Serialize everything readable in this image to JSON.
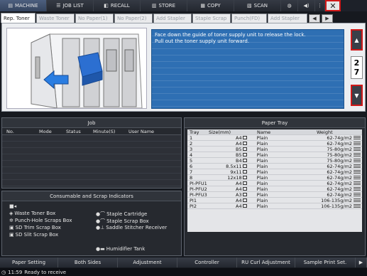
{
  "topbar": {
    "tabs": [
      {
        "label": "MACHINE",
        "icon": "machine-icon"
      },
      {
        "label": "JOB LIST",
        "icon": "list-icon"
      },
      {
        "label": "RECALL",
        "icon": "recall-icon"
      },
      {
        "label": "STORE",
        "icon": "store-icon"
      },
      {
        "label": "COPY",
        "icon": "copy-icon"
      },
      {
        "label": "SCAN",
        "icon": "scan-icon"
      }
    ],
    "close_label": "✕"
  },
  "tabs": [
    "Rep. Toner",
    "Waste Toner",
    "No Paper(1)",
    "No Paper(2)",
    "Add Stapler",
    "Staple Scrap",
    "Punch(FD)",
    "Add Stapler"
  ],
  "guidance": {
    "line1": "Face down the guide of toner supply unit to release the lock.",
    "line2": "Pull out the toner supply unit forward.",
    "page_current": "2",
    "page_total": "7"
  },
  "job": {
    "title": "Job",
    "columns": [
      "No.",
      "Mode",
      "Status",
      "Minute(S)",
      "User Name"
    ]
  },
  "paper_tray": {
    "title": "Paper Tray",
    "columns": [
      "Tray",
      "Size(mm)",
      "Name",
      "Weight"
    ],
    "rows": [
      {
        "tray": "1",
        "size": "A4",
        "name": "Plain",
        "weight": "62-74g/m2"
      },
      {
        "tray": "2",
        "size": "A4",
        "name": "Plain",
        "weight": "62-74g/m2"
      },
      {
        "tray": "3",
        "size": "B5",
        "name": "Plain",
        "weight": "75-80g/m2"
      },
      {
        "tray": "4",
        "size": "B5",
        "name": "Plain",
        "weight": "75-80g/m2"
      },
      {
        "tray": "5",
        "size": "B4",
        "name": "Plain",
        "weight": "75-80g/m2"
      },
      {
        "tray": "6",
        "size": "8.5x11",
        "name": "Plain",
        "weight": "62-74g/m2"
      },
      {
        "tray": "7",
        "size": "9x11",
        "name": "Plain",
        "weight": "62-74g/m2"
      },
      {
        "tray": "8",
        "size": "12x18",
        "name": "Plain",
        "weight": "62-74g/m2"
      },
      {
        "tray": "PI-PFU1",
        "size": "A4",
        "name": "Plain",
        "weight": "62-74g/m2"
      },
      {
        "tray": "PI-PFU2",
        "size": "A4",
        "name": "Plain",
        "weight": "62-74g/m2"
      },
      {
        "tray": "PI-PFU3",
        "size": "A3",
        "name": "Plain",
        "weight": "62-74g/m2"
      },
      {
        "tray": "PI1",
        "size": "A4",
        "name": "Plain",
        "weight": "106-135g/m2"
      },
      {
        "tray": "PI2",
        "size": "A4",
        "name": "Plain",
        "weight": "106-135g/m2"
      }
    ]
  },
  "consumables": {
    "title": "Consumable and Scrap Indicators",
    "items": [
      "Waste Toner Box",
      "Punch-Hole Scraps Box",
      "SD Trim Scrap Box",
      "SD Slit Scrap Box",
      "Staple Cartridge",
      "Staple Scrap Box",
      "Saddle Stitcher Receiver",
      "Humidifier Tank"
    ]
  },
  "bottombar": [
    "Paper Setting",
    "Both Sides",
    "Adjustment",
    "Controller",
    "RU Curl Adjustment",
    "Sample Print Set."
  ],
  "status": {
    "time": "11:59",
    "message": "Ready to receive"
  }
}
